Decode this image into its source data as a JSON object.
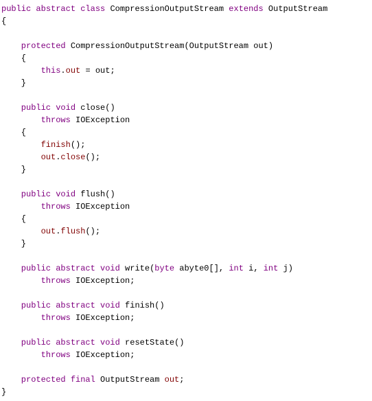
{
  "kw": {
    "public": "public",
    "abstract": "abstract",
    "class": "class",
    "extends": "extends",
    "protected": "protected",
    "void": "void",
    "throws": "throws",
    "int": "int",
    "final": "final",
    "byte": "byte",
    "this": "this"
  },
  "types": {
    "CompressionOutputStream": "CompressionOutputStream",
    "OutputStream": "OutputStream",
    "IOException": "IOException"
  },
  "members": {
    "out": "out",
    "close": "close",
    "flush": "flush",
    "finish": "finish"
  },
  "methods": {
    "close": "close",
    "flush": "flush",
    "write": "write",
    "finish": "finish",
    "resetState": "resetState"
  },
  "params": {
    "out": "out",
    "abyte0": "abyte0",
    "i": "i",
    "j": "j"
  },
  "punc": {
    "lbrace": "{",
    "rbrace": "}",
    "lparen": "(",
    "rparen": ")",
    "semicolon": ";",
    "comma": ",",
    "dot": ".",
    "eq": "=",
    "brackets": "[]"
  }
}
